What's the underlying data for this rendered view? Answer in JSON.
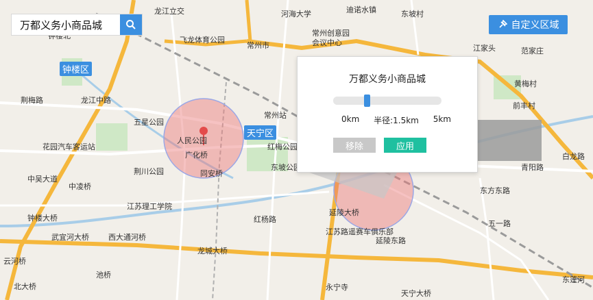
{
  "search": {
    "value": "万都义务小商品城"
  },
  "custom_region_button": {
    "label": "自定义区域"
  },
  "popup": {
    "title": "万都义务小商品城",
    "slider_min_label": "0km",
    "radius_label": "半径:1.5km",
    "slider_max_label": "5km",
    "radius_fraction": 0.3,
    "remove_label": "移除",
    "apply_label": "应用"
  },
  "districts": {
    "zhonglou": "钟楼区",
    "tianning": "天宁区"
  },
  "map_labels": {
    "longjiang_overpass": "龙江立交",
    "hehai_univ": "河海大学",
    "dichuan_water": "迪诺水镇",
    "dongpo": "东坡村",
    "feilong_park": "飞龙体育公园",
    "changzhou_city": "常州市",
    "creative_park": "常州创意园",
    "conference": "会议中心",
    "jiangjiatou": "江家头",
    "fanjiazhuang": "范家庄",
    "zhonglou_north": "钟楼北",
    "jingchi": "荆梅路",
    "longjiang_mid": "龙江中路",
    "wuxing_park": "五星公园",
    "people_park": "人民公园",
    "guanghua_bridge": "广化桥",
    "changzhou_station": "常州站",
    "hongmei_park": "红梅公园",
    "huayuan_station": "花园汽车客运站",
    "jingchuan_park": "荆川公园",
    "tongan_bridge": "同安桥",
    "dongpo_park": "东坡公园",
    "zhongwu": "中吴大道",
    "zhongling_bridge": "中凌桥",
    "jiangsu_tech": "江苏理工学院",
    "zhonglou_bridge": "钟楼大桥",
    "wujin_bridge": "武宜河大桥",
    "xida_river": "西大通河桥",
    "longcheng_bridge": "龙城大桥",
    "yanling_bridge": "延陵大桥",
    "jiangsu_road": "江苏路遥赛车俱乐部",
    "yanling_east": "延陵东路",
    "chihu": "池桥",
    "wuyi_road": "五一路",
    "yongning_temple": "永宁寺",
    "tianning_bridge": "天宁大桥",
    "dongfang_east": "东方东路",
    "qingyang": "青阳路",
    "huangmei": "黄梅村",
    "baiyun": "白龙路",
    "dongfangzhou": "东蓬河",
    "beidaqiao": "北大桥",
    "yunhe": "云河桥",
    "hongling": "红杨路",
    "qianfeng": "前丰村"
  }
}
